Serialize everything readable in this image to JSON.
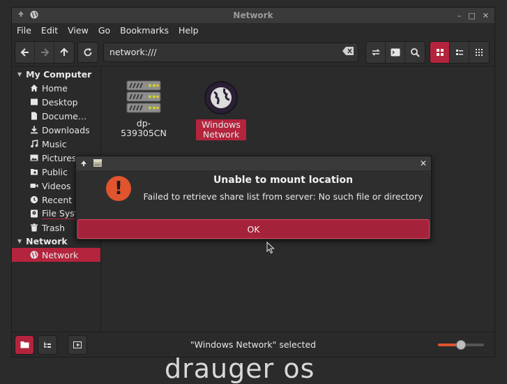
{
  "window": {
    "title": "Network",
    "controls": {
      "minimize": "–",
      "maximize": "□",
      "close": "✕"
    }
  },
  "menubar": [
    "File",
    "Edit",
    "View",
    "Go",
    "Bookmarks",
    "Help"
  ],
  "toolbar": {
    "location": "network:///"
  },
  "sidebar": {
    "sections": [
      {
        "header": "My Computer",
        "items": [
          {
            "label": "Home",
            "icon": "home-icon"
          },
          {
            "label": "Desktop",
            "icon": "desktop-icon"
          },
          {
            "label": "Docume…",
            "icon": "document-icon"
          },
          {
            "label": "Downloads",
            "icon": "download-icon"
          },
          {
            "label": "Music",
            "icon": "music-icon"
          },
          {
            "label": "Pictures",
            "icon": "picture-icon"
          },
          {
            "label": "Public",
            "icon": "public-folder-icon"
          },
          {
            "label": "Videos",
            "icon": "video-icon"
          },
          {
            "label": "Recent",
            "icon": "clock-icon"
          },
          {
            "label": "File Syst",
            "icon": "drive-icon"
          },
          {
            "label": "Trash",
            "icon": "trash-icon"
          }
        ]
      },
      {
        "header": "Network",
        "items": [
          {
            "label": "Network",
            "icon": "globe-icon",
            "selected": true
          }
        ]
      }
    ]
  },
  "content": {
    "items": [
      {
        "label": "dp-539305CN",
        "icon": "server-icon"
      },
      {
        "label": "Windows Network",
        "label_lines": [
          "Windows",
          "Network"
        ],
        "icon": "globe-icon",
        "selected": true
      }
    ]
  },
  "statusbar": {
    "text": "\"Windows Network\" selected",
    "zoom_level": 0.5
  },
  "dialog": {
    "title": "Unable to mount location",
    "message": "Failed to retrieve share list from server: No such file or directory",
    "ok_label": "OK",
    "close": "✕"
  },
  "desktop_text": "drauger os",
  "colors": {
    "accent": "#b4243c",
    "warning": "#e0542e",
    "background": "#2b2b2b"
  }
}
